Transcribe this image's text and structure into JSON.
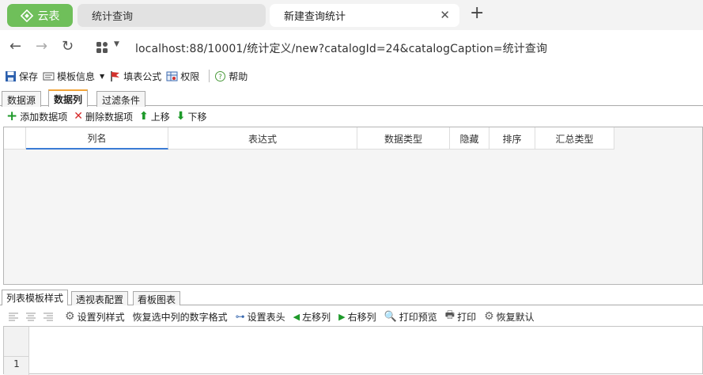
{
  "browser": {
    "brand_tab": "云表",
    "tabs": [
      {
        "title": "统计查询"
      },
      {
        "title": "新建查询统计"
      }
    ],
    "url": "localhost:88/10001/统计定义/new?catalogId=24&catalogCaption=统计查询"
  },
  "toolbar": {
    "save": "保存",
    "template_info": "模板信息",
    "fill_formula": "填表公式",
    "permission": "权限",
    "help": "帮助"
  },
  "panel_tabs": [
    "数据源",
    "数据列",
    "过滤条件"
  ],
  "item_toolbar": {
    "add": "添加数据项",
    "delete": "删除数据项",
    "up": "上移",
    "down": "下移"
  },
  "grid": {
    "columns": [
      "列名",
      "表达式",
      "数据类型",
      "隐藏",
      "排序",
      "汇总类型"
    ]
  },
  "lower_tabs": [
    "列表模板样式",
    "透视表配置",
    "看板图表"
  ],
  "style_toolbar": {
    "set_column_style": "设置列样式",
    "restore_number_format": "恢复选中列的数字格式",
    "set_header": "设置表头",
    "move_left": "左移列",
    "move_right": "右移列",
    "print_preview": "打印预览",
    "print": "打印",
    "restore_default": "恢复默认"
  },
  "sheet": {
    "row_number": "1"
  },
  "colors": {
    "brand": "#6fbf5a",
    "accent_tab": "#f2a53a",
    "selected_col": "#3a7bd5"
  }
}
